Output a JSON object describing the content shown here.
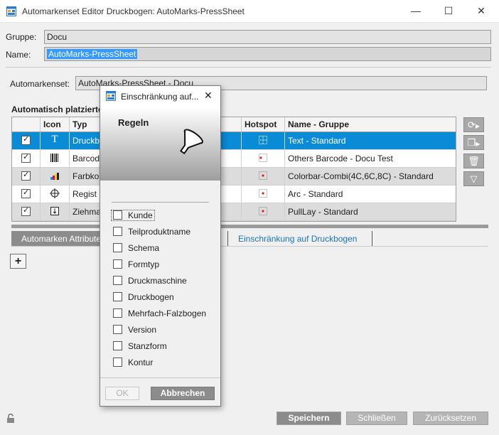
{
  "window": {
    "title": "Automarkenset Editor Druckbogen: AutoMarks-PressSheet",
    "minimize": "—",
    "maximize": "☐",
    "close": "✕"
  },
  "form": {
    "gruppe_label": "Gruppe:",
    "gruppe_value": "Docu",
    "name_label": "Name:",
    "name_value": "AutoMarks-PressSheet",
    "automarkenset_label": "Automarkenset:",
    "automarkenset_value": "AutoMarks-PressSheet - Docu"
  },
  "section": {
    "title": "Automatisch platzierte"
  },
  "table": {
    "headers": [
      "Icon",
      "Typ",
      "Hotspot",
      "Name - Gruppe"
    ],
    "rows": [
      {
        "icon": "T",
        "typ": "Druckb",
        "name": "Text - Standard",
        "checked": true,
        "selected": true
      },
      {
        "icon": "barcode",
        "typ": "Barcod",
        "name": "Others Barcode - Docu Test",
        "checked": true
      },
      {
        "icon": "colorbar",
        "typ": "Farbko",
        "name": "Colorbar-Combi(4C,6C,8C) - Standard",
        "checked": true
      },
      {
        "icon": "register",
        "typ": "Regist",
        "name": "Arc - Standard",
        "checked": true
      },
      {
        "icon": "pull",
        "typ": "Ziehma",
        "name": "PullLay - Standard",
        "checked": true
      }
    ]
  },
  "tabs": {
    "tab1": "Automarken Attribute",
    "tab2": "Einschränkung auf Druckbogen"
  },
  "add_button": "+",
  "buttons": {
    "save": "Speichern",
    "close": "Schließen",
    "reset": "Zurücksetzen"
  },
  "modal": {
    "title": "Einschränkung auf...",
    "close": "✕",
    "header": "Regeln",
    "criteria": [
      "Kunde",
      "Teilproduktname",
      "Schema",
      "Formtyp",
      "Druckmaschine",
      "Druckbogen",
      "Mehrfach-Falzbogen",
      "Version",
      "Stanzform",
      "Kontur"
    ],
    "ok": "OK",
    "cancel": "Abbrechen"
  },
  "colors": {
    "selection": "#0a8bd6",
    "link_tab": "#1a73b8",
    "button_gray": "#b5b5b5"
  }
}
